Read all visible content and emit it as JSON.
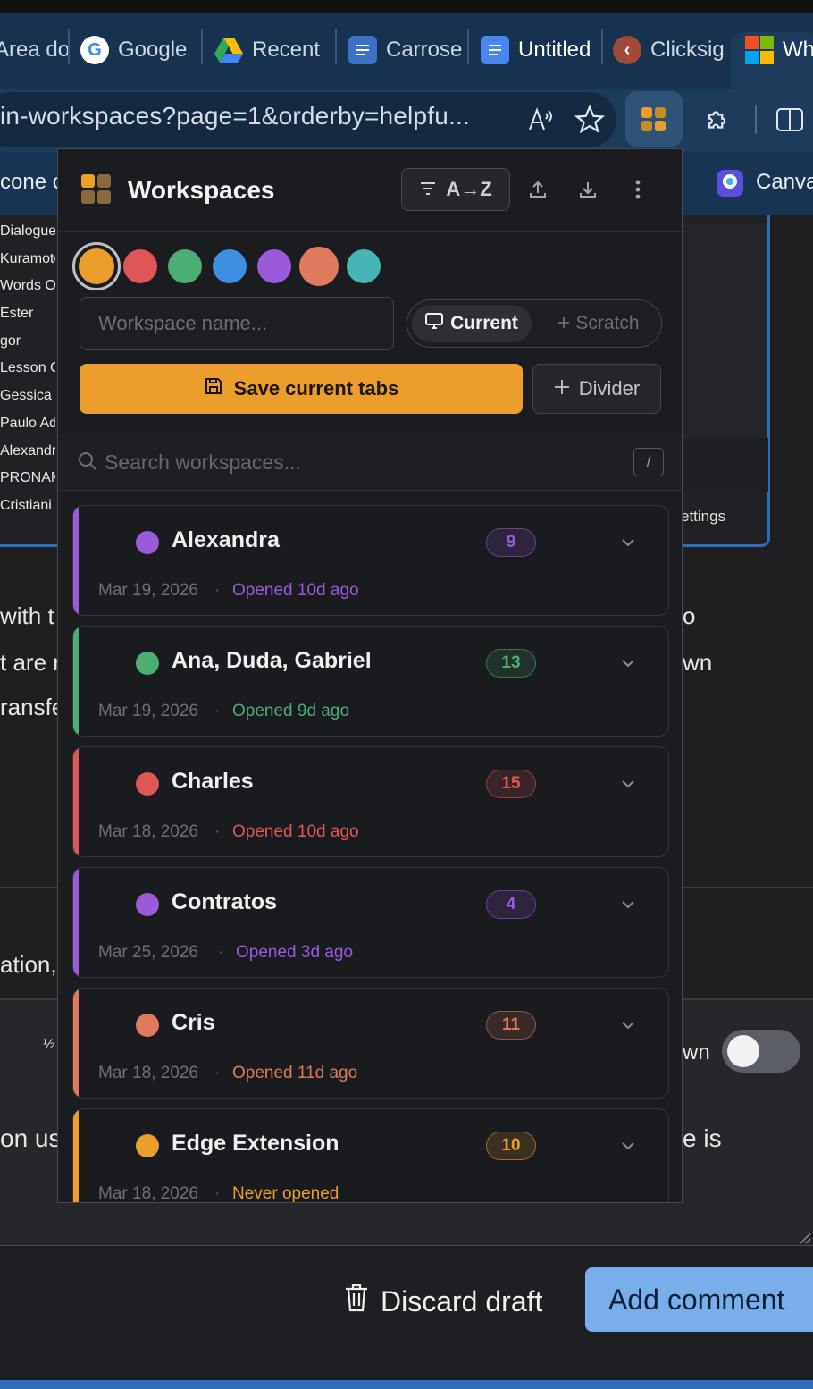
{
  "browser": {
    "tabs": [
      {
        "label": "Area do"
      },
      {
        "label": "Google",
        "icon": "google-icon"
      },
      {
        "label": "Recent",
        "icon": "google-drive-icon"
      },
      {
        "label": "Carrose",
        "icon": "google-docs-icon"
      },
      {
        "label": "Untitled",
        "icon": "google-docs-icon"
      },
      {
        "label": "Clicksig",
        "icon": "clicksign-icon"
      },
      {
        "label": "Wh",
        "icon": "microsoft-icon"
      }
    ],
    "url": "in-workspaces?page=1&orderby=helpfu...",
    "bookmarks": {
      "left": "cone c",
      "right": "Canva"
    }
  },
  "background_page": {
    "list": [
      "Dialogue",
      "Kuramoto",
      "Words Of",
      "Ester",
      "gor",
      "Lesson C",
      "Gessica",
      "Paulo Ad",
      "Alexandra",
      "PRONAM",
      "Cristiani"
    ],
    "settings_label": "ettings",
    "left_text": [
      "with t",
      "t are r",
      "ransfe",
      "ation,",
      "on us"
    ],
    "right_text": [
      "o",
      "wn",
      "wn",
      "e is"
    ],
    "fraction_icon": "½",
    "discard_label": "Discard draft",
    "add_comment_label": "Add comment"
  },
  "popup": {
    "title": "Workspaces",
    "sort_label": "A→Z",
    "colors": [
      "#eb9e2b",
      "#df5656",
      "#4cae73",
      "#3d8fe0",
      "#9b5ad9",
      "#e07a5f",
      "#45b5b5"
    ],
    "selected_color_index": 0,
    "name_placeholder": "Workspace name...",
    "mode_current": "Current",
    "mode_scratch": "Scratch",
    "save_label": "Save current tabs",
    "divider_label": "Divider",
    "search_placeholder": "Search workspaces...",
    "search_shortcut": "/",
    "workspaces": [
      {
        "name": "Alexandra",
        "count": "9",
        "date": "Mar 19, 2026",
        "opened": "Opened 10d ago",
        "color": "#9b5ad9"
      },
      {
        "name": "Ana, Duda, Gabriel",
        "count": "13",
        "date": "Mar 19, 2026",
        "opened": "Opened 9d ago",
        "color": "#4cae73"
      },
      {
        "name": "Charles",
        "count": "15",
        "date": "Mar 18, 2026",
        "opened": "Opened 10d ago",
        "color": "#df5656"
      },
      {
        "name": "Contratos",
        "count": "4",
        "date": "Mar 25, 2026",
        "opened": "Opened 3d ago",
        "color": "#9b5ad9"
      },
      {
        "name": "Cris",
        "count": "11",
        "date": "Mar 18, 2026",
        "opened": "Opened 11d ago",
        "color": "#e07a5f"
      },
      {
        "name": "Edge Extension",
        "count": "10",
        "date": "Mar 18, 2026",
        "opened": "Never opened",
        "color": "#eb9e2b"
      }
    ]
  }
}
